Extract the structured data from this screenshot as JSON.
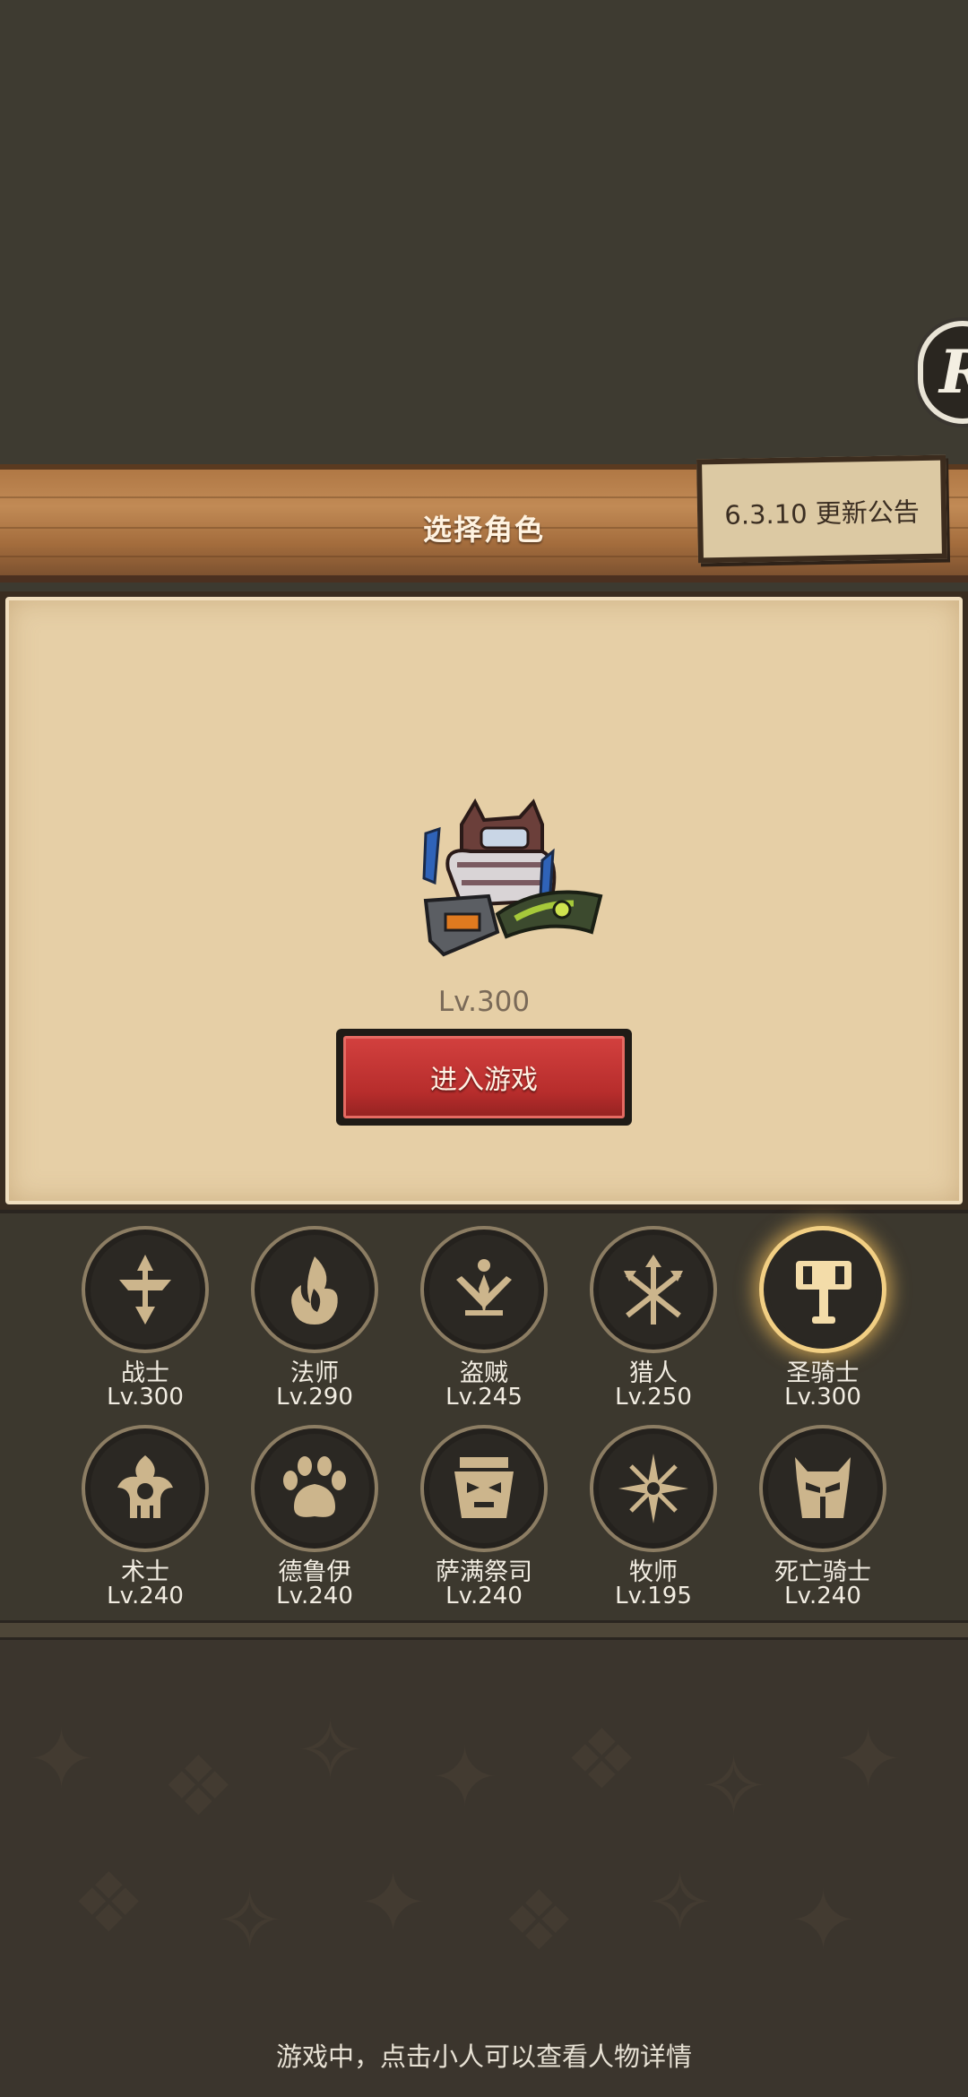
{
  "header": {
    "title": "选择角色",
    "notice_label": "6.3.10 更新公告",
    "float_button_glyph": "R"
  },
  "selected_character": {
    "level": "Lv.300",
    "enter_button_label": "进入游戏"
  },
  "classes": [
    {
      "name": "战士",
      "level": "Lv.300",
      "icon": "warrior-sword-icon"
    },
    {
      "name": "法师",
      "level": "Lv.290",
      "icon": "mage-flame-icon"
    },
    {
      "name": "盗贼",
      "level": "Lv.245",
      "icon": "rogue-daggers-icon"
    },
    {
      "name": "猎人",
      "level": "Lv.250",
      "icon": "hunter-arrows-icon"
    },
    {
      "name": "圣骑士",
      "level": "Lv.300",
      "icon": "paladin-hammer-icon",
      "selected": true
    },
    {
      "name": "术士",
      "level": "Lv.240",
      "icon": "warlock-skull-icon"
    },
    {
      "name": "德鲁伊",
      "level": "Lv.240",
      "icon": "druid-paw-icon"
    },
    {
      "name": "萨满祭司",
      "level": "Lv.240",
      "icon": "shaman-totem-icon"
    },
    {
      "name": "牧师",
      "level": "Lv.195",
      "icon": "priest-star-icon"
    },
    {
      "name": "死亡骑士",
      "level": "Lv.240",
      "icon": "deathknight-helm-icon"
    }
  ],
  "footer": {
    "hint": "游戏中，点击小人可以查看人物详情"
  },
  "colors": {
    "accent_red": "#b72d2c",
    "selected_glow": "#f2cf83",
    "parchment": "#e6cfa6",
    "wood": "#b07845"
  }
}
